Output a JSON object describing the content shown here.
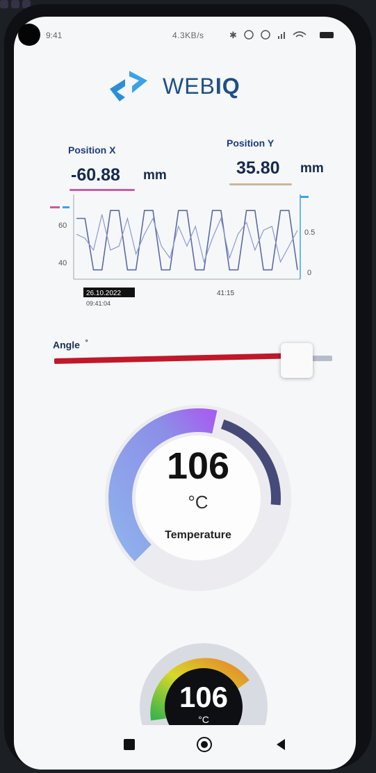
{
  "status_bar": {
    "time": "9:41",
    "network_speed": "4.3KB/s"
  },
  "app": {
    "logo_text_light": "WEB",
    "logo_text_bold": "IQ",
    "brand_color": "#2b8fd6"
  },
  "position_x": {
    "label": "Position X",
    "value": "-60.88",
    "unit": "mm",
    "accent": "#c45fa0"
  },
  "position_y": {
    "label": "Position Y",
    "value": "35.80",
    "unit": "mm",
    "accent": "#c9b79a"
  },
  "chart_data": {
    "type": "line",
    "left_axis": {
      "ticks": [
        "60",
        "40"
      ],
      "ylim": [
        30,
        70
      ]
    },
    "right_axis": {
      "ticks": [
        "0.5",
        "0"
      ],
      "ylim": [
        0,
        1
      ]
    },
    "x_ticks": [
      "26.10.2022",
      "09:41:04",
      "41:15"
    ],
    "series": [
      {
        "values": [
          60,
          60,
          34,
          34,
          64,
          64,
          34,
          34,
          64,
          64,
          34,
          34,
          64,
          64,
          34,
          34,
          64,
          64,
          34,
          34,
          64,
          64,
          34,
          34,
          64,
          64,
          34
        ]
      },
      {
        "values": [
          52,
          50,
          44,
          62,
          44,
          46,
          60,
          42,
          52,
          60,
          46,
          40,
          56,
          46,
          56,
          38,
          50,
          60,
          40,
          52,
          58,
          44,
          54,
          56,
          38,
          46,
          54
        ]
      }
    ]
  },
  "angle": {
    "label": "Angle",
    "unit": "°",
    "value": 0.86,
    "accent": "#c0182a"
  },
  "temperature_gauge": {
    "value": "106",
    "unit": "°C",
    "label": "Temperature",
    "level": 0.88
  },
  "temperature_gauge_small": {
    "value": "106",
    "unit": "°C"
  },
  "nav": {
    "recents": "recents-button",
    "home": "home-button",
    "back": "back-button"
  }
}
